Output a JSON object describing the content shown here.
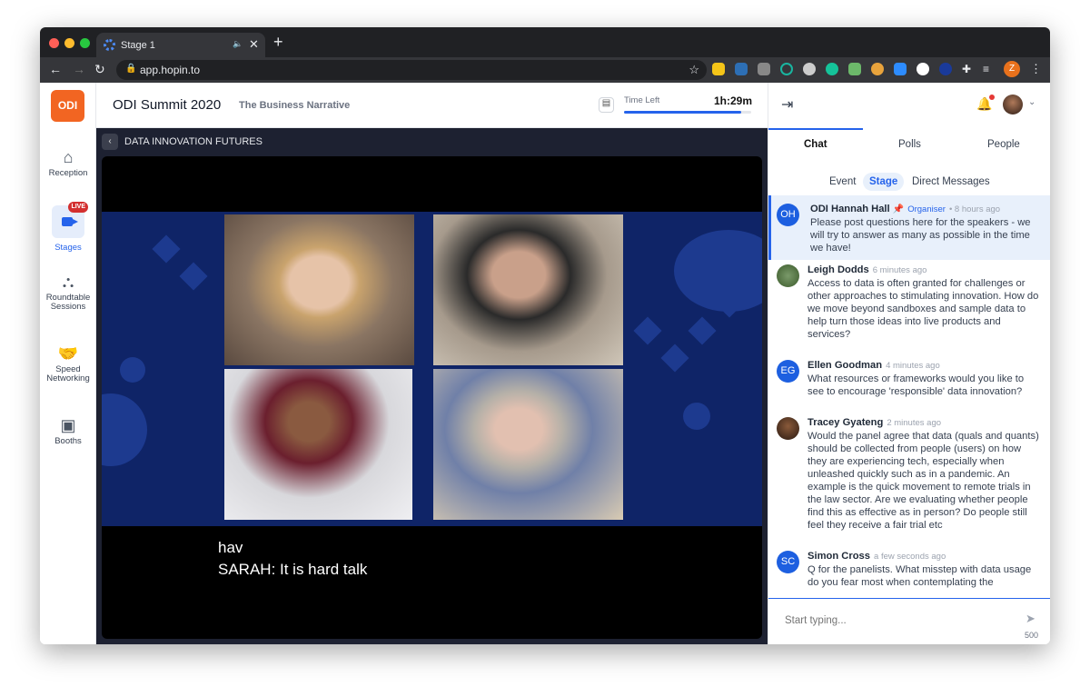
{
  "browser": {
    "tab_title": "Stage 1",
    "url": "app.hopin.to",
    "profile_initial": "Z"
  },
  "brand": {
    "logo_text": "ODI",
    "accent": "#2563eb",
    "logo_color": "#f26522"
  },
  "sidebar": {
    "items": [
      {
        "label": "Reception",
        "icon": "home-icon"
      },
      {
        "label": "Stages",
        "icon": "video-camera-icon",
        "badge": "LIVE",
        "active": true
      },
      {
        "label": "Roundtable Sessions",
        "icon": "people-table-icon"
      },
      {
        "label": "Speed Networking",
        "icon": "handshake-icon"
      },
      {
        "label": "Booths",
        "icon": "booth-icon"
      }
    ]
  },
  "header": {
    "title": "ODI Summit 2020",
    "subtitle": "The Business Narrative",
    "time_left_label": "Time Left",
    "time_left_value": "1h:29m",
    "time_progress_percent": 92
  },
  "stage": {
    "name": "DATA INNOVATION FUTURES",
    "captions": [
      "hav",
      "SARAH:  It is hard talk"
    ]
  },
  "panel": {
    "tabs": [
      "Chat",
      "Polls",
      "People"
    ],
    "active_tab": "Chat",
    "subtabs": [
      "Event",
      "Stage",
      "Direct Messages"
    ],
    "active_subtab": "Stage",
    "messages": [
      {
        "initials": "OH",
        "name": "ODI Hannah Hall",
        "role": "Organiser",
        "time": "8 hours ago",
        "text": "Please post questions here for the speakers - we will try to answer as many as possible in the time we have!",
        "pinned": true
      },
      {
        "initials": "",
        "name": "Leigh Dodds",
        "time": "6 minutes ago",
        "text": "Access to data is often granted for challenges or other approaches to stimulating innovation. How do we move beyond sandboxes and sample data to help turn those ideas into live products and services?"
      },
      {
        "initials": "EG",
        "name": "Ellen Goodman",
        "time": "4 minutes ago",
        "text": "What resources or frameworks would you like to see to encourage 'responsible' data innovation?"
      },
      {
        "initials": "",
        "name": "Tracey Gyateng",
        "time": "2 minutes ago",
        "text": "Would the panel agree that data (quals and quants) should be collected from people (users) on how they are experiencing tech, especially when unleashed quickly such as in a pandemic. An example is the quick movement to remote trials in the law sector. Are we evaluating whether people find this as effective as in person? Do people still feel they receive a fair trial etc"
      },
      {
        "initials": "SC",
        "name": "Simon Cross",
        "time": "a few seconds ago",
        "text": "Q for the panelists. What misstep with data usage do you fear most when contemplating the"
      }
    ],
    "input_placeholder": "Start typing...",
    "char_count": "500"
  }
}
